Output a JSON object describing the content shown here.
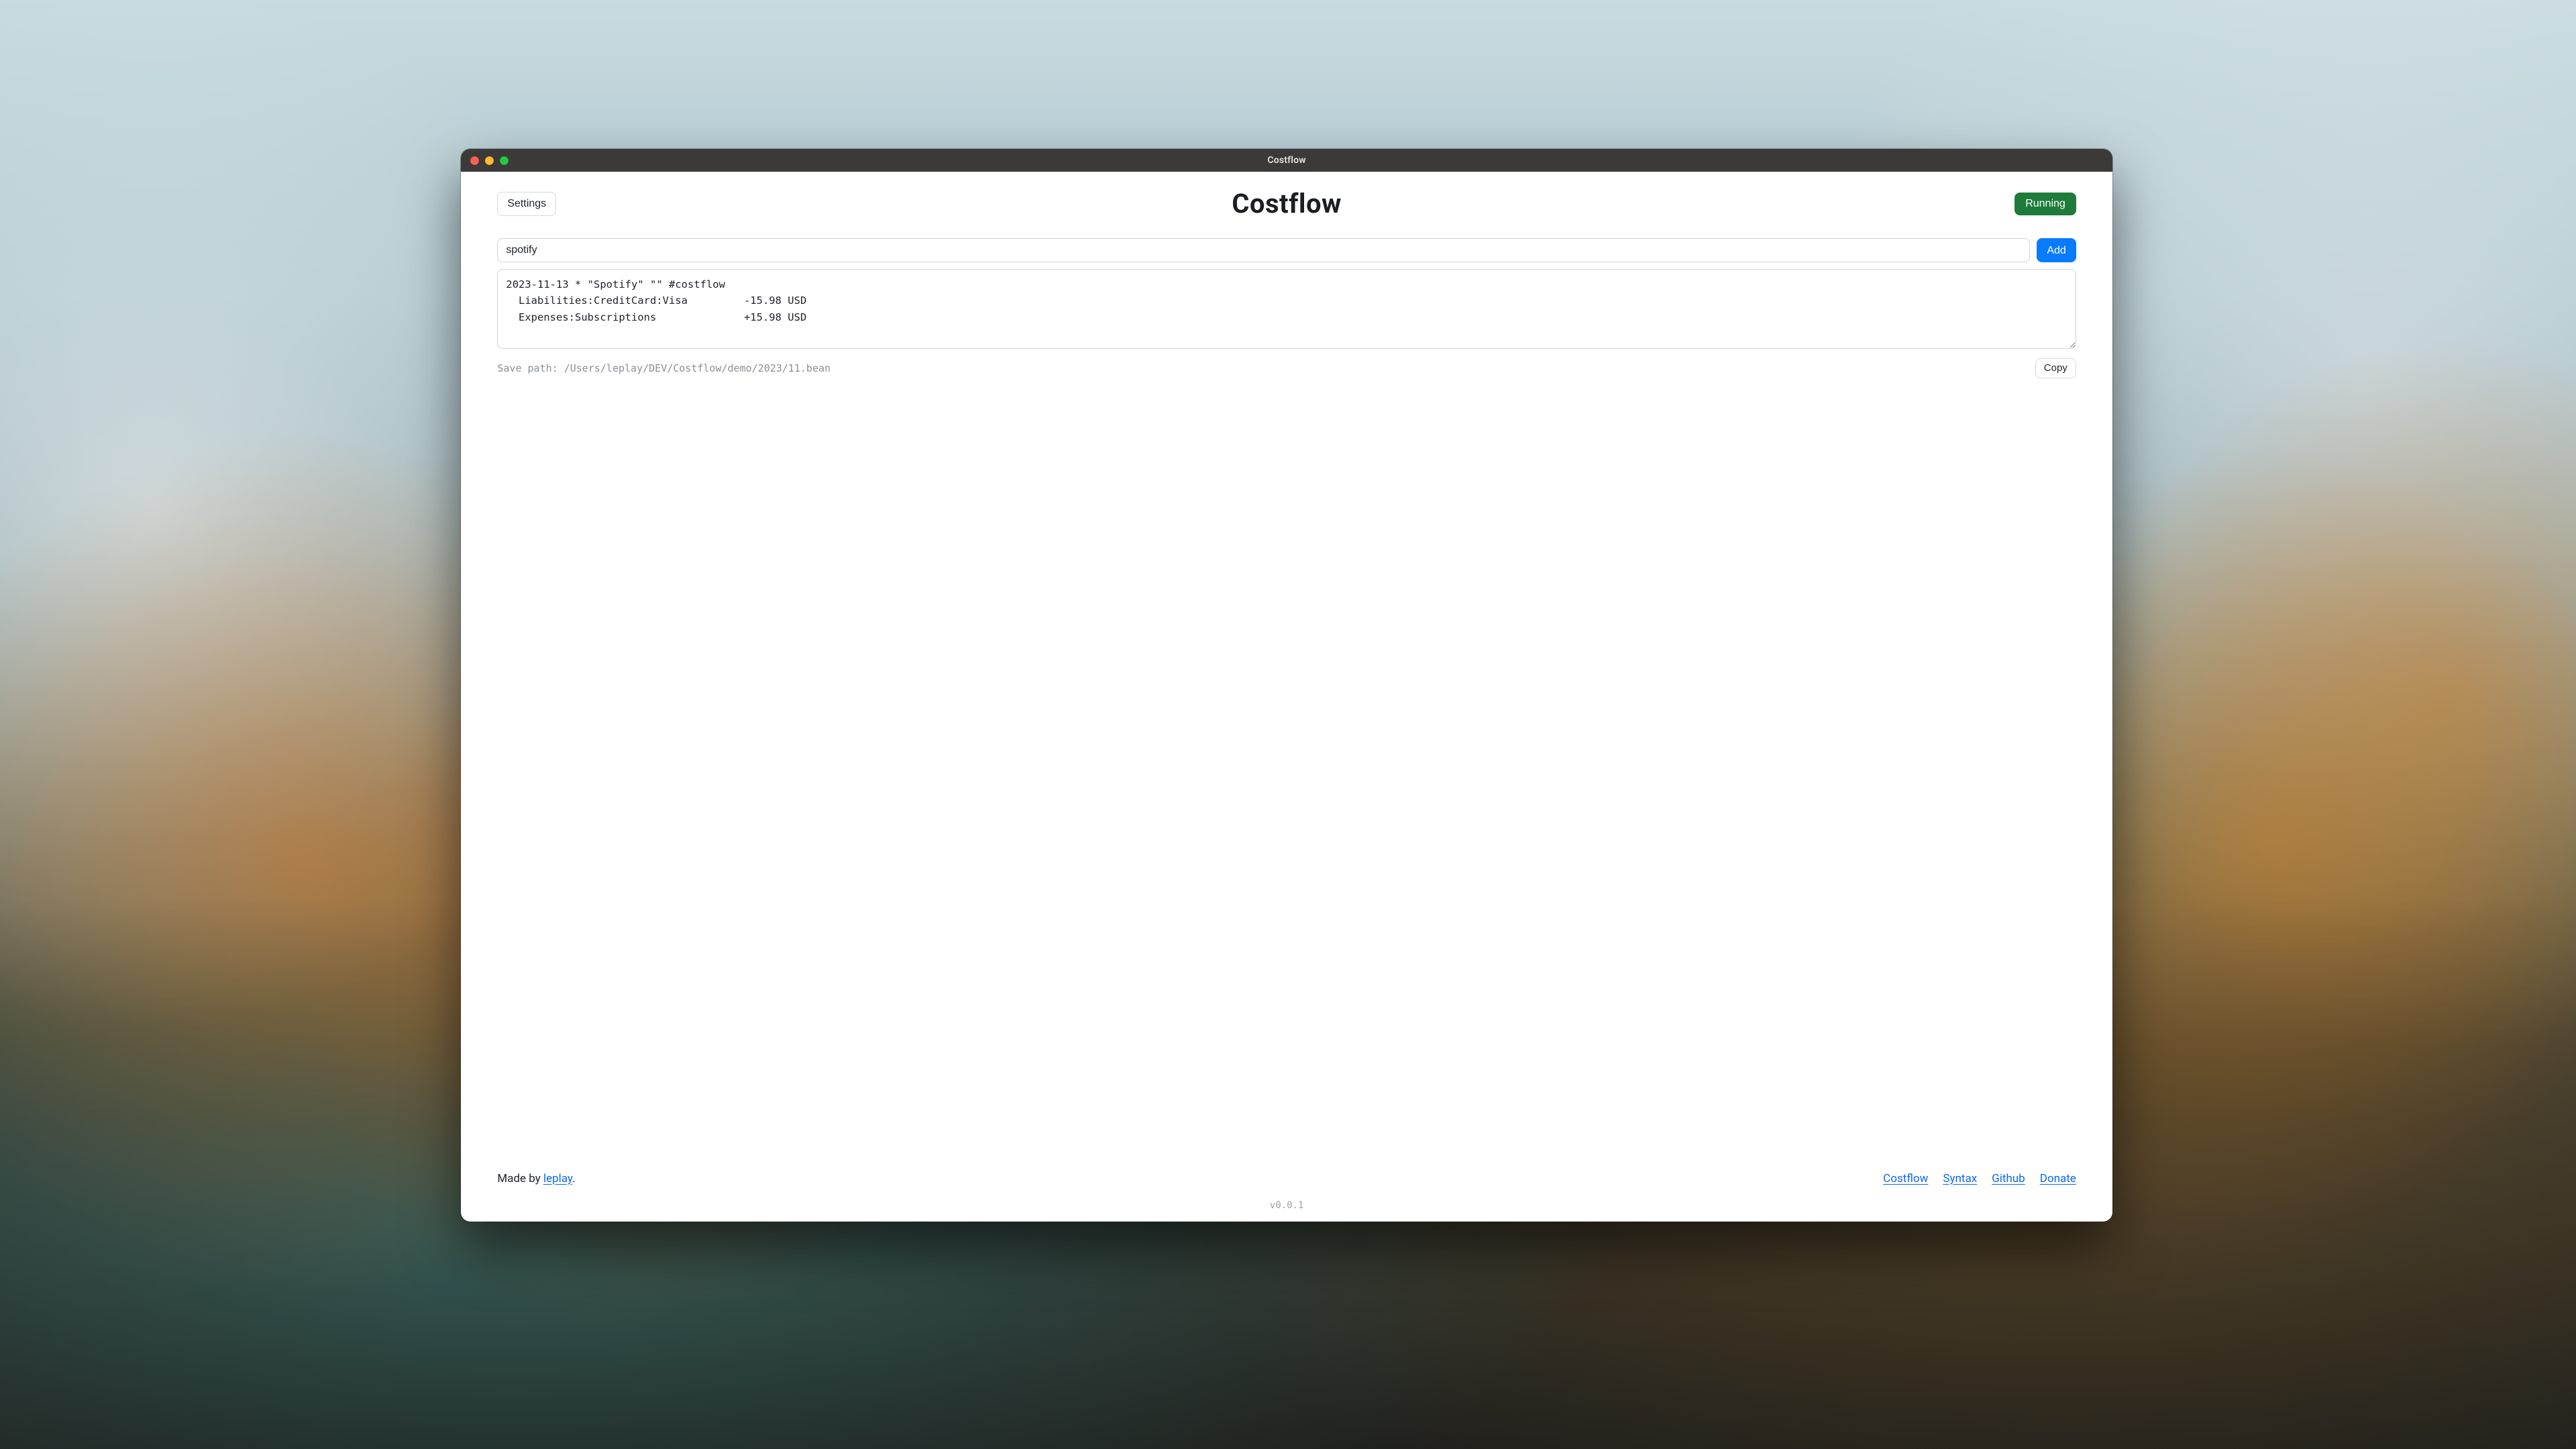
{
  "window": {
    "title": "Costflow"
  },
  "header": {
    "settings_label": "Settings",
    "app_title": "Costflow",
    "status_label": "Running"
  },
  "input": {
    "value": "spotify",
    "add_label": "Add"
  },
  "output": {
    "text": "2023-11-13 * \"Spotify\" \"\" #costflow\n  Liabilities:CreditCard:Visa         -15.98 USD\n  Expenses:Subscriptions              +15.98 USD"
  },
  "save": {
    "path_text": "Save path: /Users/leplay/DEV/Costflow/demo/2023/11.bean",
    "copy_label": "Copy"
  },
  "footer": {
    "made_by_prefix": "Made by ",
    "made_by_link": "leplay",
    "made_by_suffix": ".",
    "links": {
      "costflow": "Costflow",
      "syntax": "Syntax",
      "github": "Github",
      "donate": "Donate"
    }
  },
  "version": "v0.0.1"
}
